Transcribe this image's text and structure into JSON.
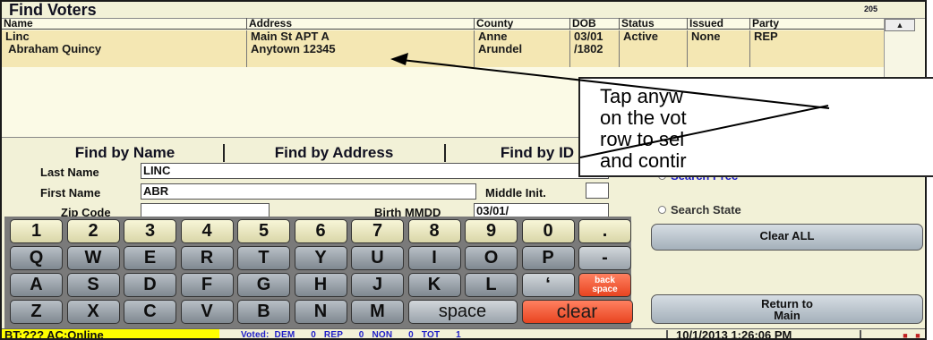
{
  "window": {
    "title": "Find Voters",
    "count": "205"
  },
  "grid": {
    "columns": [
      "Name",
      "Address",
      "County",
      "DOB",
      "Status",
      "Issued",
      "Party"
    ],
    "rows": [
      {
        "name_line1": "Linc",
        "name_line2": " Abraham Quincy",
        "address_line1": "Main St APT A",
        "address_line2": "Anytown 12345",
        "county_line1": "Anne",
        "county_line2": "Arundel",
        "dob_line1": "03/01",
        "dob_line2": "/1802",
        "status": "Active",
        "issued": "None",
        "party": "REP"
      }
    ],
    "scroll_up_glyph": "▲"
  },
  "tabs": [
    "Find by Name",
    "Find by Address",
    "Find by ID"
  ],
  "form": {
    "last_name_label": "Last Name",
    "last_name_value": "LINC",
    "first_name_label": "First Name",
    "first_name_value": "ABR",
    "middle_label": "Middle Init.",
    "middle_value": "",
    "zip_label": "Zip Code",
    "zip_value": "",
    "birth_label": "Birth MMDD",
    "birth_value": "03/01/"
  },
  "search_options": [
    {
      "label": "Search Prec",
      "selected": true
    },
    {
      "label": "Search State",
      "selected": false
    }
  ],
  "keyboard": {
    "row1": [
      "1",
      "2",
      "3",
      "4",
      "5",
      "6",
      "7",
      "8",
      "9",
      "0",
      "."
    ],
    "row2": [
      "Q",
      "W",
      "E",
      "R",
      "T",
      "Y",
      "U",
      "I",
      "O",
      "P",
      "-"
    ],
    "row3": [
      "A",
      "S",
      "D",
      "F",
      "G",
      "H",
      "J",
      "K",
      "L",
      "‘"
    ],
    "backspace_line1": "back",
    "backspace_line2": "space",
    "row4": [
      "Z",
      "X",
      "C",
      "V",
      "B",
      "N",
      "M"
    ],
    "space_label": "space",
    "clear_label": "clear"
  },
  "buttons": {
    "clear_all": "Clear ALL",
    "return_line1": "Return to",
    "return_line2": "Main"
  },
  "status_bar": {
    "bt": "BT:??? AC:Online",
    "voted": "Voted:  DEM      0   REP      0   NON      0   TOT      1",
    "datetime": "10/1/2013 1:26:06 PM"
  },
  "callout": {
    "lines": [
      "Tap anyw",
      "on the vot",
      "row to sel",
      "and contir"
    ]
  },
  "colors": {
    "background": "#f2f1d7",
    "selected_row": "#f4e7b3",
    "status_yellow": "#ffff00",
    "link_blue": "#2020c8",
    "clear_orange": "#e84420"
  }
}
